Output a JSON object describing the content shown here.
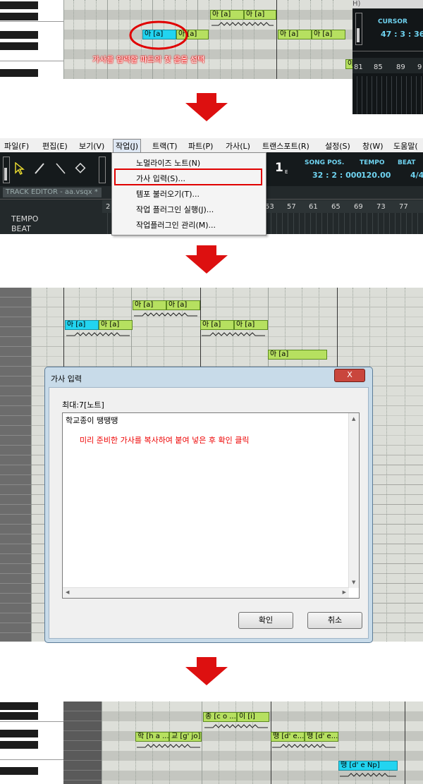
{
  "step1": {
    "instruction": "가사를 입력할 파트의 첫 음을 선택",
    "notes": [
      "아 [a]",
      "아 [a]",
      "아 [a]",
      "아 [a]",
      "아 [a]",
      "아 [a]",
      "아 [a]"
    ],
    "cursor_panel": {
      "header": "H)",
      "label": "CURSOR",
      "value": "47 : 3 : 360",
      "ruler": [
        "81",
        "85",
        "89",
        "9"
      ]
    }
  },
  "step2": {
    "menu": [
      "파일(F)",
      "편집(E)",
      "보기(V)",
      "작업(J)",
      "트랙(T)",
      "파트(P)",
      "가사(L)",
      "트랜스포트(R)",
      "설정(S)",
      "창(W)",
      "도움말("
    ],
    "dropdown": [
      "노멀라이즈 노트(N)",
      "가사 입력(S)...",
      "템포 불러오기(T)...",
      "작업 플러그인 실행(J)...",
      "작업플러그인 관리(M)..."
    ],
    "song_pos_label": "SONG POS.",
    "song_pos_value": "32 : 2 : 000",
    "tempo_label": "TEMPO",
    "tempo_value": "120.00",
    "beat_label": "BEAT",
    "beat_value": "4/4",
    "track_editor_title": "TRACK EDITOR - aa.vsqx *",
    "track_labels": [
      "TEMPO",
      "BEAT"
    ],
    "ruler": [
      "2",
      "53",
      "57",
      "61",
      "65",
      "69",
      "73",
      "77"
    ],
    "big_number": "1"
  },
  "step3": {
    "notes": [
      "아 [a]",
      "아 [a]",
      "아 [a]",
      "아 [a]",
      "아 [a]",
      "아 [a]",
      "아 [a]"
    ],
    "dialog": {
      "title": "가사 입력",
      "close": "X",
      "max_label": "최대:7[노트]",
      "text_value": "학교종이 땡땡땡",
      "instruction": "미리 준비한 가사를 복사하여 붙여 넣은 후 확인 클릭",
      "ok": "확인",
      "cancel": "취소"
    }
  },
  "step4": {
    "notes": [
      "종 [c o ...",
      "이 [i]",
      "학 [h a ...",
      "교 [g' jo]",
      "땡 [d' e...",
      "땡 [d' e...",
      "땡 [d' e Np]"
    ]
  },
  "colors": {
    "note": "#b6e060",
    "selected_note": "#22d4f0",
    "highlight": "#e00000",
    "arrow": "#dd1010"
  }
}
